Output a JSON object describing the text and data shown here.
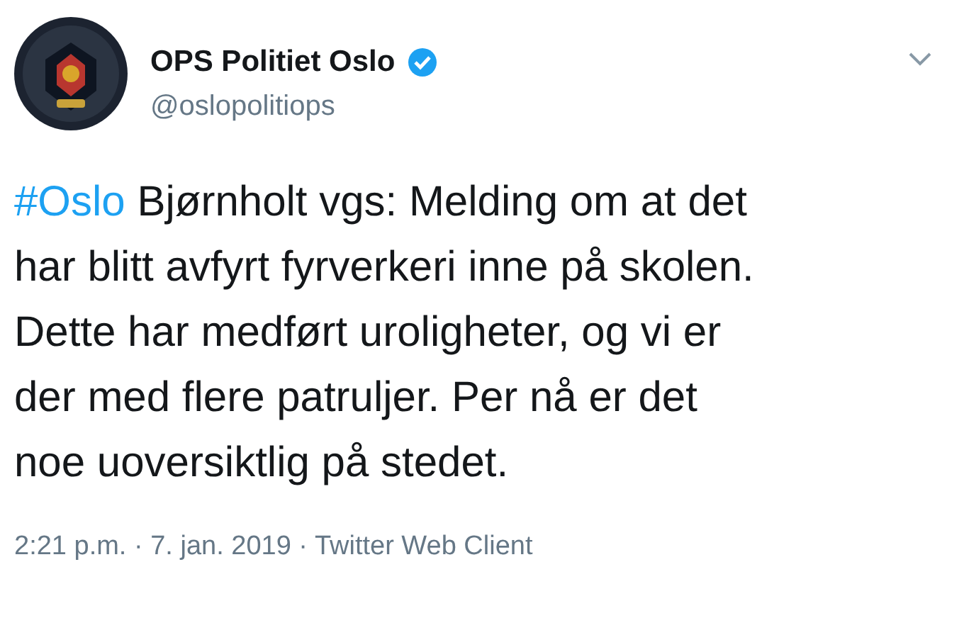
{
  "author": {
    "name": "OPS Politiet Oslo",
    "verified": true,
    "handle": "@oslopolitiops"
  },
  "tweet": {
    "hashtag": "#Oslo",
    "lines": [
      "Bjørnholt vgs: Melding om at det",
      "har blitt avfyrt fyrverkeri inne på skolen.",
      "Dette har medført uroligheter, og vi er",
      "der med flere patruljer. Per nå er det",
      "noe uoversiktlig på stedet."
    ]
  },
  "footer": "2:21 p.m. · 7. jan. 2019 · Twitter Web Client"
}
